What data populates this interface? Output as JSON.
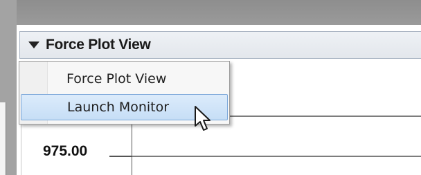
{
  "view_selector": {
    "selected_label": "Force Plot View",
    "icon": "caret-down-icon"
  },
  "menu": {
    "items": [
      {
        "label": "Force Plot View",
        "highlighted": false
      },
      {
        "label": "Launch Monitor",
        "highlighted": true
      }
    ]
  },
  "plot": {
    "y_tick_label": "975.00"
  },
  "cursor": {
    "icon": "arrow-cursor-icon"
  }
}
